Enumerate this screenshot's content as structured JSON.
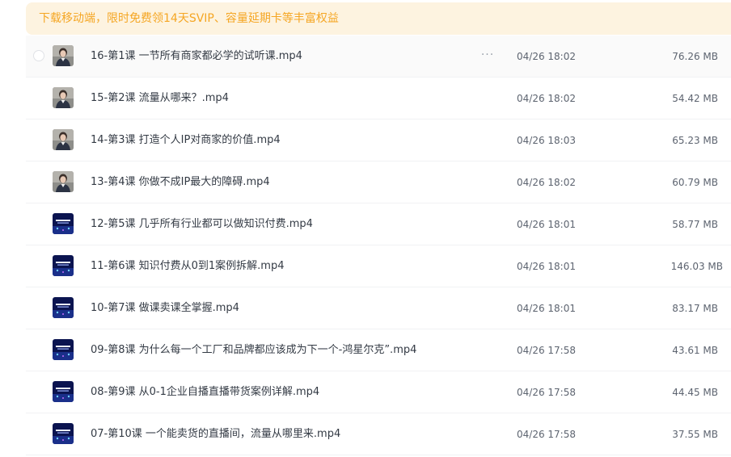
{
  "promo": {
    "text": "下载移动端，限时免费领14天SVIP、容量延期卡等丰富权益"
  },
  "files": [
    {
      "name": "16-第1课 一节所有商家都必学的试听课.mp4",
      "date": "04/26 18:02",
      "size": "76.26 MB",
      "thumb": "portrait-icon"
    },
    {
      "name": "15-第2课 流量从哪来？.mp4",
      "date": "04/26 18:02",
      "size": "54.42 MB",
      "thumb": "portrait-icon"
    },
    {
      "name": "14-第3课 打造个人IP对商家的价值.mp4",
      "date": "04/26 18:03",
      "size": "65.23 MB",
      "thumb": "portrait-icon"
    },
    {
      "name": "13-第4课 你做不成IP最大的障碍.mp4",
      "date": "04/26 18:02",
      "size": "60.79 MB",
      "thumb": "portrait-icon"
    },
    {
      "name": "12-第5课 几乎所有行业都可以做知识付费.mp4",
      "date": "04/26 18:01",
      "size": "58.77 MB",
      "thumb": "slide-icon"
    },
    {
      "name": "11-第6课 知识付费从0到1案例拆解.mp4",
      "date": "04/26 18:01",
      "size": "146.03 MB",
      "thumb": "slide-icon"
    },
    {
      "name": "10-第7课 做课卖课全掌握.mp4",
      "date": "04/26 18:01",
      "size": "83.17 MB",
      "thumb": "slide-icon"
    },
    {
      "name": "09-第8课 为什么每一个工厂和品牌都应该成为下一个-鸿星尔克”.mp4",
      "date": "04/26 17:58",
      "size": "43.61 MB",
      "thumb": "slide-icon"
    },
    {
      "name": "08-第9课 从0-1企业自播直播带货案例详解.mp4",
      "date": "04/26 17:58",
      "size": "44.45 MB",
      "thumb": "slide-icon"
    },
    {
      "name": "07-第10课 一个能卖货的直播间，流量从哪里来.mp4",
      "date": "04/26 17:58",
      "size": "37.55 MB",
      "thumb": "slide-icon"
    }
  ],
  "more_glyph": "···",
  "colors": {
    "promo_bg": "#fdf3e0",
    "promo_text": "#f5a623",
    "text_primary": "#333a44",
    "text_secondary": "#5d6470"
  }
}
